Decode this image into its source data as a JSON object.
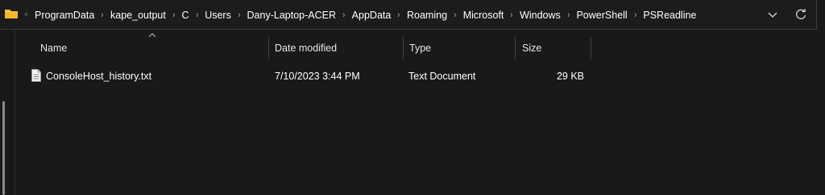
{
  "address_bar": {
    "overflow": "«",
    "crumbs": [
      "ProgramData",
      "kape_output",
      "C",
      "Users",
      "Dany-Laptop-ACER",
      "AppData",
      "Roaming",
      "Microsoft",
      "Windows",
      "PowerShell",
      "PSReadline"
    ],
    "separator": "›"
  },
  "columns": {
    "name": "Name",
    "date_modified": "Date modified",
    "type": "Type",
    "size": "Size"
  },
  "files": [
    {
      "name": "ConsoleHost_history.txt",
      "date_modified": "7/10/2023 3:44 PM",
      "type": "Text Document",
      "size": "29 KB",
      "icon": "text-file-icon"
    }
  ],
  "colors": {
    "background": "#191919",
    "text": "#ffffff",
    "folder_yellow": "#f8c842",
    "divider": "#444444"
  }
}
